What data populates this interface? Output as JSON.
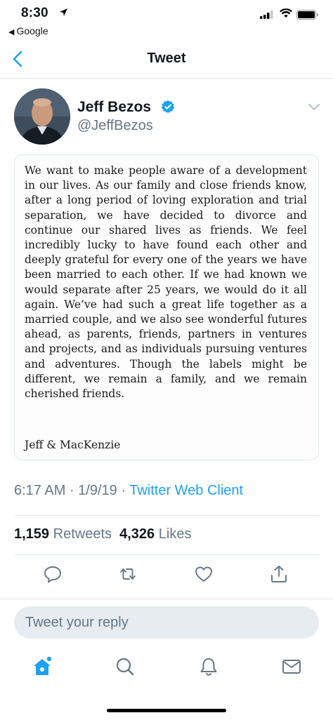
{
  "status_bar": {
    "time": "8:30",
    "back_app": "Google"
  },
  "navbar": {
    "title": "Tweet"
  },
  "tweet": {
    "author_name": "Jeff Bezos",
    "handle": "@JeffBezos",
    "verified": true,
    "statement": "We want to make people aware of a development in our lives. As our family and close friends know, after a long period of loving exploration and trial separation, we have decided to divorce and continue our shared lives as friends.  We feel incredibly lucky to have found each other and deeply grateful for every one of the years we have been married to each other.  If we had known we would separate after 25 years, we would do it all again.  We’ve had such a great life together as a married couple, and we also see wonderful futures ahead, as parents, friends, partners in ventures and projects, and as individuals pursuing ventures and adventures.  Though the labels might be different, we remain a family, and we remain cherished friends.",
    "signoff": "Jeff & MacKenzie",
    "time": "6:17 AM",
    "date": "1/9/19",
    "client": "Twitter Web Client",
    "retweets_count": "1,159",
    "retweets_label": "Retweets",
    "likes_count": "4,326",
    "likes_label": "Likes"
  },
  "actions": {
    "icons": [
      "reply-icon",
      "retweet-icon",
      "like-icon",
      "share-icon"
    ]
  },
  "reply": {
    "placeholder": "Tweet your reply"
  },
  "tab_bar": {
    "icons": [
      "home-icon",
      "search-icon",
      "notifications-icon",
      "messages-icon"
    ]
  },
  "colors": {
    "accent": "#1da1f2",
    "secondary_text": "#657786",
    "divider": "#e1e8ed"
  }
}
